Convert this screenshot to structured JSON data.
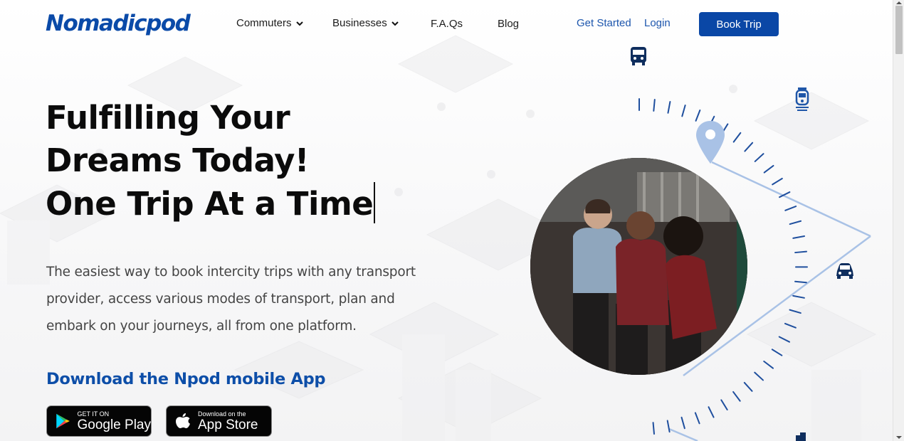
{
  "brand": {
    "logo_text": "Nomadicpod",
    "accent": "#0a47a6"
  },
  "nav": {
    "items": [
      {
        "label": "Commuters",
        "has_dropdown": true
      },
      {
        "label": "Businesses",
        "has_dropdown": true
      },
      {
        "label": "F.A.Qs",
        "has_dropdown": false
      },
      {
        "label": "Blog",
        "has_dropdown": false
      }
    ],
    "get_started": "Get Started",
    "login": "Login",
    "book_trip": "Book Trip"
  },
  "hero": {
    "title_line1": "Fulfilling Your",
    "title_line2": "Dreams Today!",
    "title_line3": "One Trip At a Time",
    "description": "The easiest way to book intercity trips with any transport provider, access various modes of transport, plan and embark on your journeys, all from one platform.",
    "app_heading": "Download the Npod mobile App"
  },
  "stores": {
    "google_small": "GET IT ON",
    "google_big": "Google Play",
    "apple_small": "Download on the",
    "apple_big": "App Store"
  },
  "visual": {
    "icons": [
      "bus-icon",
      "train-icon",
      "car-icon",
      "location-pin-icon"
    ]
  }
}
